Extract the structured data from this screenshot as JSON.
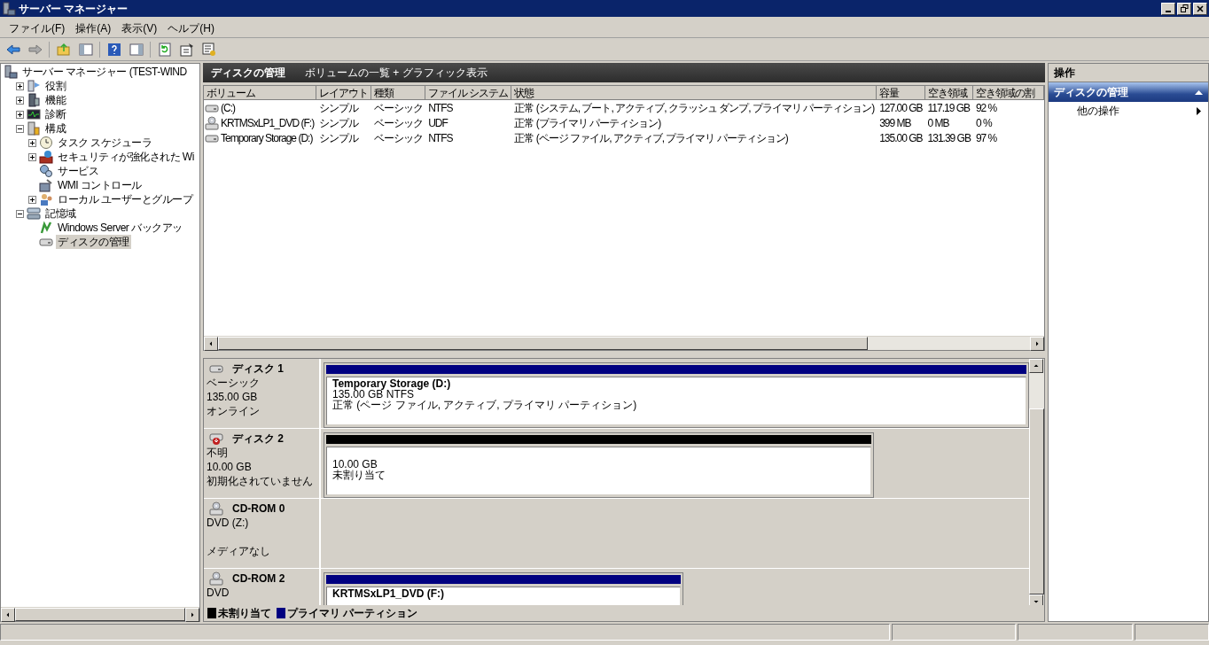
{
  "window": {
    "title": "サーバー マネージャー"
  },
  "menu": [
    "ファイル(F)",
    "操作(A)",
    "表示(V)",
    "ヘルプ(H)"
  ],
  "tree": {
    "label": "サーバー マネージャー (TEST-WIND",
    "selected": false,
    "children": [
      {
        "label": "役割",
        "expanded": false,
        "selected": false
      },
      {
        "label": "機能",
        "expanded": false,
        "selected": false
      },
      {
        "label": "診断",
        "expanded": false,
        "selected": false
      },
      {
        "label": "構成",
        "expanded": true,
        "selected": false,
        "children": [
          {
            "label": "タスク スケジューラ",
            "expanded": false,
            "selected": false
          },
          {
            "label": "セキュリティが強化された Wi",
            "expanded": false,
            "selected": false
          },
          {
            "label": "サービス",
            "selected": false
          },
          {
            "label": "WMI コントロール",
            "selected": false
          },
          {
            "label": "ローカル ユーザーとグループ",
            "expanded": false,
            "selected": false
          }
        ]
      },
      {
        "label": "記憶域",
        "expanded": true,
        "selected": false,
        "children": [
          {
            "label": "Windows Server バックアッ",
            "selected": false
          },
          {
            "label": "ディスクの管理",
            "selected": true
          }
        ]
      }
    ]
  },
  "center": {
    "title": "ディスクの管理",
    "subtitle": "ボリュームの一覧 + グラフィック表示"
  },
  "volumes": {
    "columns": [
      "ボリューム",
      "レイアウト",
      "種類",
      "ファイル システム",
      "状態",
      "容量",
      "空き領域",
      "空き領域の割"
    ],
    "rows": [
      {
        "kind": "disk",
        "cells": [
          "(C:)",
          "シンプル",
          "ベーシック",
          "NTFS",
          "正常 (システム, ブート, アクティブ, クラッシュ ダンプ, プライマリ パーティション)",
          "127.00 GB",
          "117.19 GB",
          "92 %"
        ]
      },
      {
        "kind": "cdrom",
        "cells": [
          "KRTMSxLP1_DVD (F:)",
          "シンプル",
          "ベーシック",
          "UDF",
          "正常 (プライマリ パーティション)",
          "399 MB",
          "0 MB",
          "0 %"
        ]
      },
      {
        "kind": "disk",
        "cells": [
          "Temporary Storage (D:)",
          "シンプル",
          "ベーシック",
          "NTFS",
          "正常 (ページ ファイル, アクティブ, プライマリ パーティション)",
          "135.00 GB",
          "131.39 GB",
          "97 %"
        ]
      }
    ]
  },
  "disks": [
    {
      "kind": "disk",
      "name": "ディスク 1",
      "type": "ベーシック",
      "size": "135.00 GB",
      "status": "オンライン",
      "partitions": [
        {
          "kind": "primary",
          "title": "Temporary Storage  (D:)",
          "lines": [
            "135.00 GB NTFS",
            "正常 (ページ ファイル, アクティブ, プライマリ パーティション)"
          ]
        }
      ]
    },
    {
      "kind": "disk_error",
      "name": "ディスク 2",
      "type": "不明",
      "size": "10.00 GB",
      "status": "初期化されていません",
      "partitions": [
        {
          "kind": "unallocated",
          "lines": [
            "10.00 GB",
            "未割り当て"
          ]
        }
      ]
    },
    {
      "kind": "cdrom",
      "name": "CD-ROM 0",
      "type": "DVD (Z:)",
      "status": "メディアなし"
    },
    {
      "kind": "cdrom",
      "name": "CD-ROM 2",
      "type": "DVD",
      "partitions": [
        {
          "kind": "primary",
          "title": "KRTMSxLP1_DVD  (F:)"
        }
      ]
    }
  ],
  "legend": [
    {
      "label": "未割り当て",
      "color": "#000000"
    },
    {
      "label": "プライマリ パーティション",
      "color": "#000080"
    }
  ],
  "actions": {
    "title": "操作",
    "section": "ディスクの管理",
    "expanded": true,
    "items": [
      {
        "label": "他の操作",
        "submenu": true
      }
    ]
  }
}
